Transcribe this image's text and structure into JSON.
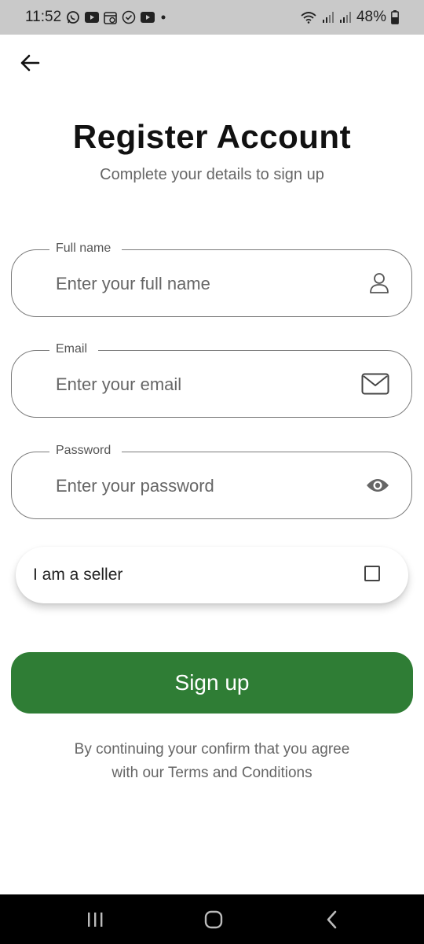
{
  "status_bar": {
    "time": "11:52",
    "battery": "48%",
    "notification_icons": [
      "whatsapp-icon",
      "youtube-icon",
      "calendar-icon",
      "check-circle-icon",
      "youtube-icon",
      "dot-icon"
    ],
    "right_icons": [
      "wifi-icon",
      "signal-icon",
      "signal-icon",
      "battery-icon"
    ]
  },
  "header": {
    "back_icon": "arrow-left-icon",
    "title": "Register Account",
    "subtitle": "Complete your details to sign up"
  },
  "form": {
    "full_name": {
      "label": "Full name",
      "placeholder": "Enter your full name",
      "value": "",
      "icon": "person-icon"
    },
    "email": {
      "label": "Email",
      "placeholder": "Enter your email",
      "value": "",
      "icon": "mail-icon"
    },
    "password": {
      "label": "Password",
      "placeholder": "Enter your password",
      "value": "",
      "icon": "eye-icon"
    },
    "seller": {
      "label": "I am a seller",
      "checked": false
    }
  },
  "signup_button": {
    "label": "Sign up"
  },
  "terms": {
    "line1": "By continuing your confirm that you agree",
    "line2": "with our Terms and Conditions"
  },
  "nav_bar": {
    "icons": [
      "recent-apps-icon",
      "home-icon",
      "back-icon"
    ]
  },
  "colors": {
    "primary": "#2f7d35",
    "status_bar_bg": "#c9c9c9",
    "nav_bar_bg": "#000000",
    "border": "#7b7b7b"
  }
}
